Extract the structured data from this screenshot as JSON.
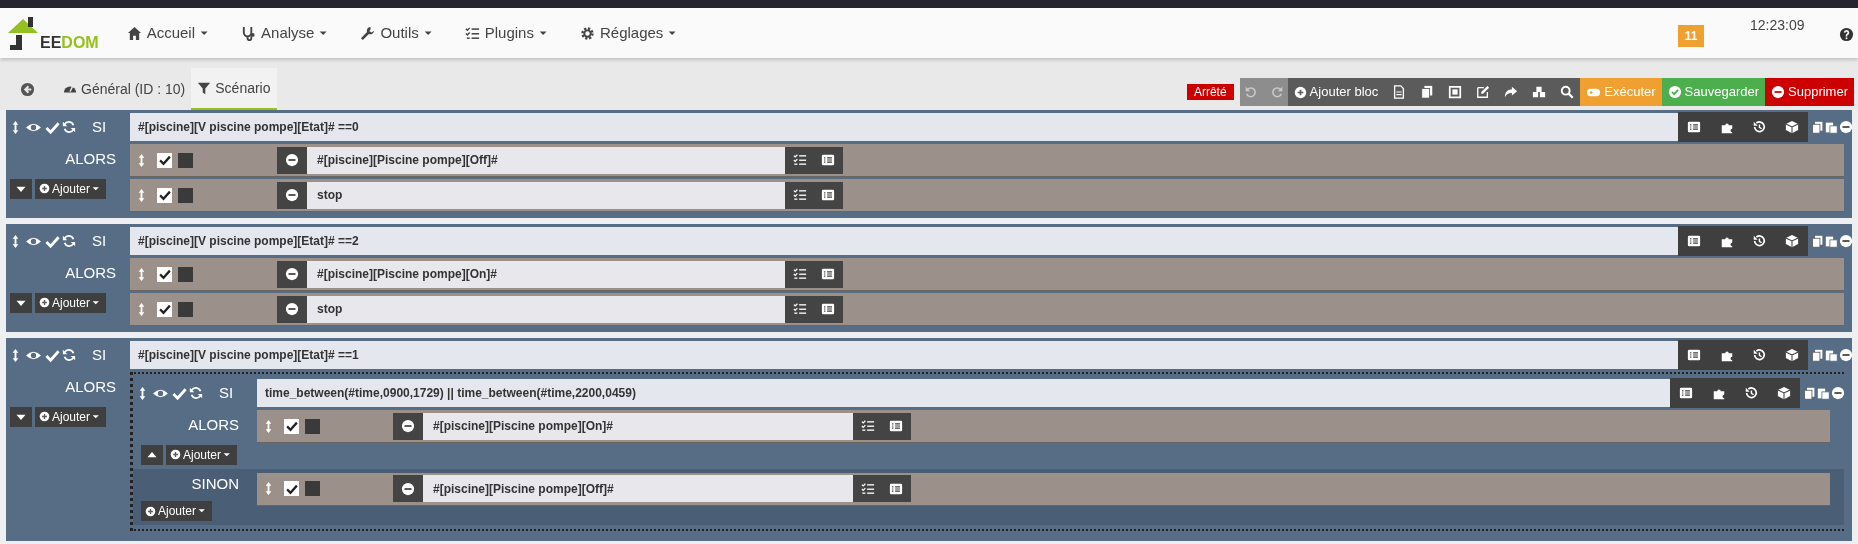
{
  "nav": {
    "logo_text": "EEDOM",
    "menus": [
      {
        "label": "Accueil"
      },
      {
        "label": "Analyse"
      },
      {
        "label": "Outils"
      },
      {
        "label": "Plugins"
      },
      {
        "label": "Réglages"
      }
    ],
    "badge": "11",
    "time": "12:23:09"
  },
  "tabs": [
    {
      "label": "Général (ID : 10)",
      "selected": false
    },
    {
      "label": "Scénario",
      "selected": true
    }
  ],
  "toolbar": {
    "status": "Arrêté",
    "add_block": "Ajouter bloc",
    "execute": "Exécuter",
    "save": "Sauvegarder",
    "delete": "Supprimer"
  },
  "blocks": [
    {
      "visible": true,
      "enabled": true,
      "keyword": "SI",
      "condition": "#[piscine][V piscine pompe][Etat]# ==0",
      "then_label": "ALORS",
      "expanded": false,
      "add_label": "Ajouter",
      "actions": [
        {
          "kind": "action",
          "enabled": true,
          "parallel": false,
          "text": "#[piscine][Piscine pompe][Off]#"
        },
        {
          "kind": "action",
          "enabled": true,
          "parallel": false,
          "text": "stop"
        }
      ]
    },
    {
      "visible": true,
      "enabled": true,
      "keyword": "SI",
      "condition": "#[piscine][V piscine pompe][Etat]# ==2",
      "then_label": "ALORS",
      "expanded": false,
      "add_label": "Ajouter",
      "actions": [
        {
          "kind": "action",
          "enabled": true,
          "parallel": false,
          "text": "#[piscine][Piscine pompe][On]#"
        },
        {
          "kind": "action",
          "enabled": true,
          "parallel": false,
          "text": "stop"
        }
      ]
    },
    {
      "visible": true,
      "enabled": true,
      "keyword": "SI",
      "condition": "#[piscine][V piscine pompe][Etat]# ==1",
      "then_label": "ALORS",
      "expanded": false,
      "add_label": "Ajouter",
      "actions": [
        {
          "kind": "block",
          "block": {
            "visible": true,
            "enabled": true,
            "keyword": "SI",
            "condition": "time_between(#time,0900,1729) || time_between(#time,2200,0459)",
            "then_label": "ALORS",
            "expanded": true,
            "add_label": "Ajouter",
            "actions": [
              {
                "kind": "action",
                "enabled": true,
                "parallel": false,
                "text": "#[piscine][Piscine pompe][On]#"
              }
            ],
            "else_label": "SINON",
            "else_add_label": "Ajouter",
            "else_actions": [
              {
                "kind": "action",
                "enabled": true,
                "parallel": false,
                "text": "#[piscine][Piscine pompe][Off]#"
              }
            ]
          }
        }
      ]
    }
  ]
}
